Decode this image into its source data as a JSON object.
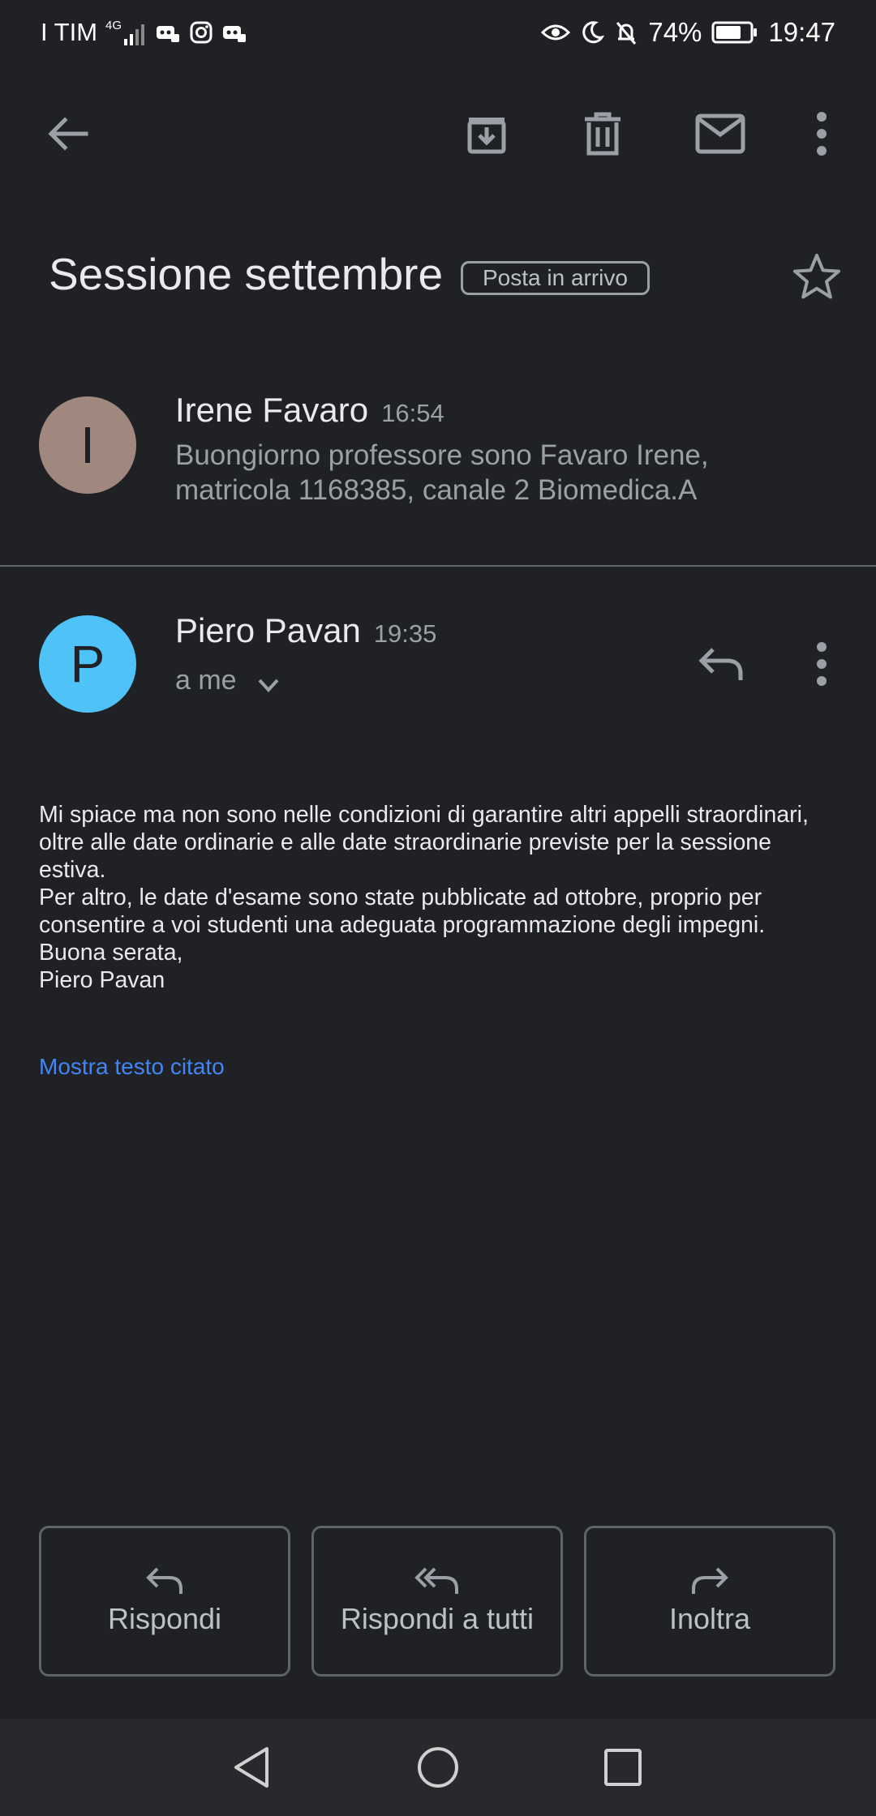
{
  "status_bar": {
    "carrier": "I TIM",
    "network": "4G",
    "battery": "74%",
    "time": "19:47"
  },
  "thread": {
    "subject": "Sessione settembre",
    "label": "Posta in arrivo"
  },
  "messages": [
    {
      "avatar_letter": "I",
      "avatar_color": "#a1887f",
      "sender": "Irene Favaro",
      "time": "16:54",
      "snippet": "Buongiorno professore sono Favaro Irene, matricola 1168385, canale 2 Biomedica.A"
    },
    {
      "avatar_letter": "P",
      "avatar_color": "#4fc3f7",
      "sender": "Piero Pavan",
      "time": "19:35",
      "recipient": "a me",
      "body": "Mi spiace ma non sono nelle condizioni di garantire altri appelli straordinari, oltre alle date ordinarie e alle date straordinarie previste per la sessione estiva.\nPer altro, le date d'esame sono state pubblicate ad ottobre, proprio per consentire a voi studenti una adeguata programmazione degli impegni.\nBuona serata,\nPiero Pavan",
      "show_quoted": "Mostra testo citato"
    }
  ],
  "actions": {
    "reply": "Rispondi",
    "reply_all": "Rispondi a tutti",
    "forward": "Inoltra"
  },
  "colors": {
    "background": "#202124",
    "link": "#4285f4"
  }
}
